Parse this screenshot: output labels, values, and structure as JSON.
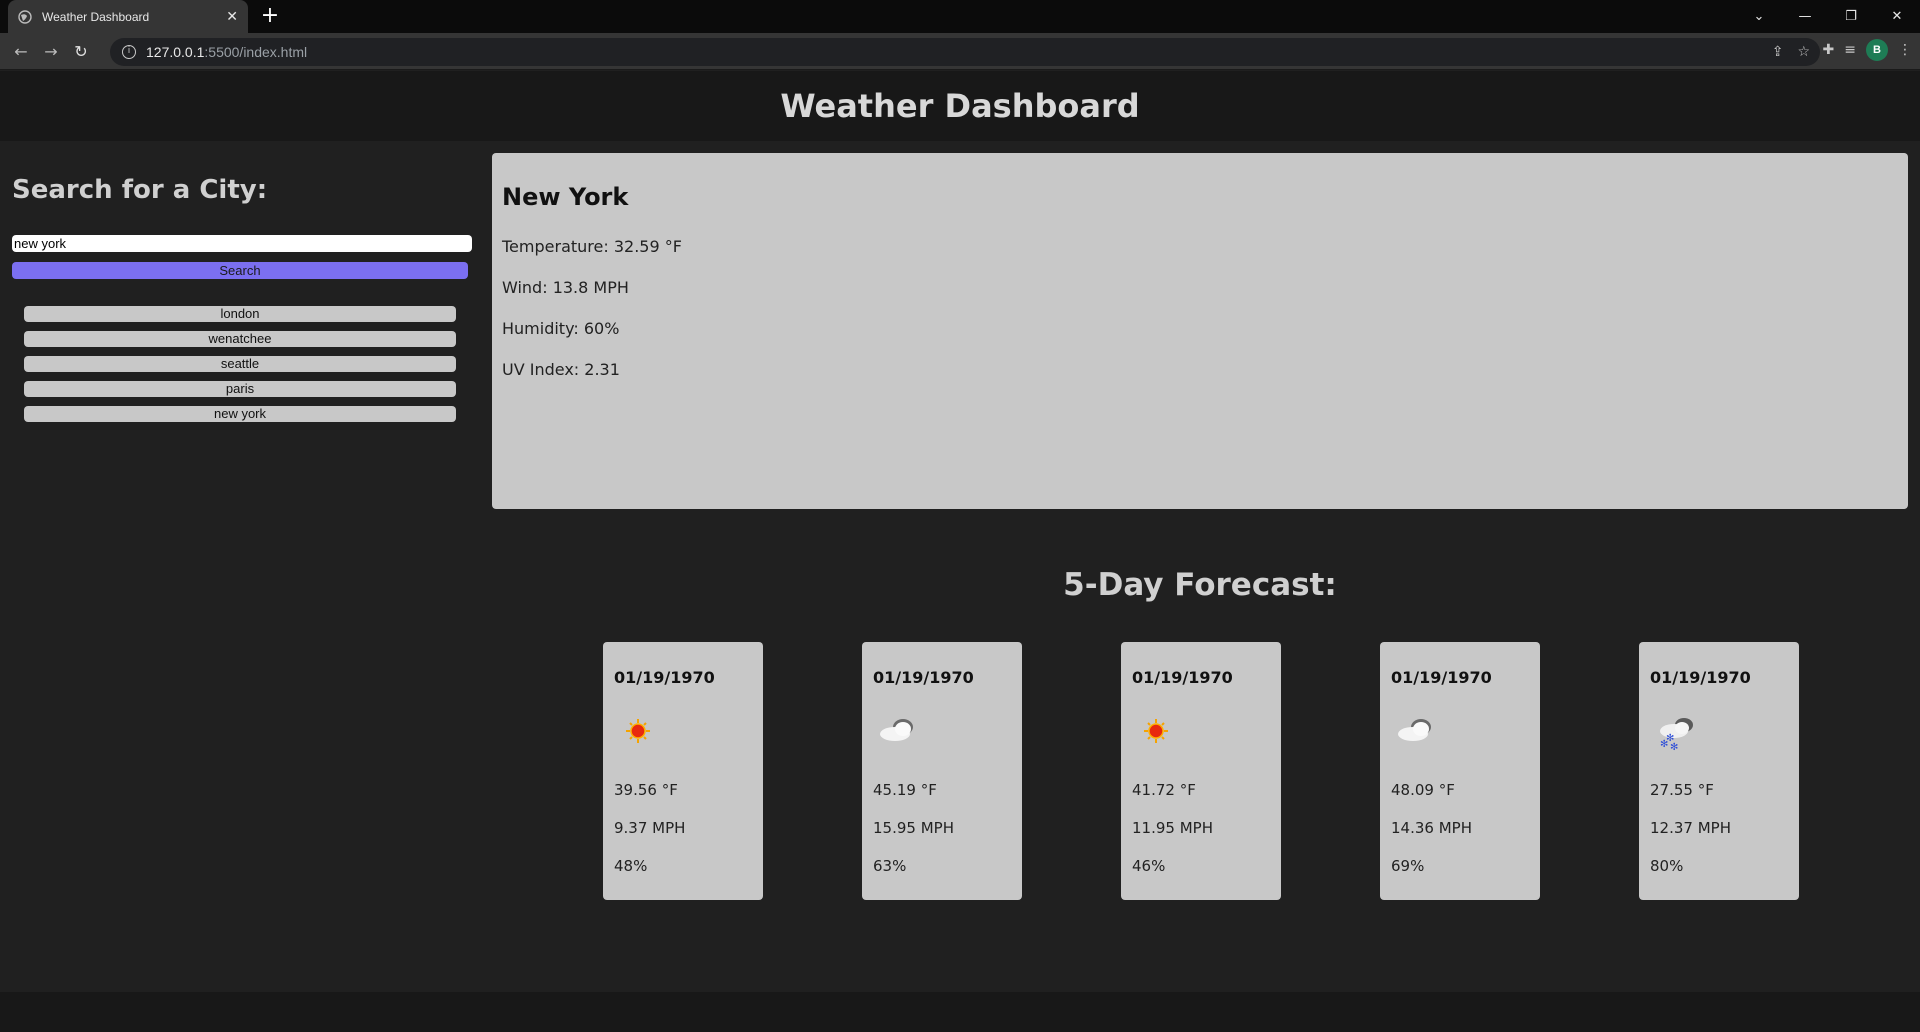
{
  "browser": {
    "tab_title": "Weather Dashboard",
    "url_host": "127.0.0.1",
    "url_path": ":5500/index.html",
    "profile_initial": "B"
  },
  "header": {
    "title": "Weather Dashboard"
  },
  "sidebar": {
    "heading": "Search for a City:",
    "search_value": "new york",
    "search_button": "Search",
    "history": [
      "london",
      "wenatchee",
      "seattle",
      "paris",
      "new york"
    ]
  },
  "current": {
    "city": "New York",
    "temperature": "Temperature: 32.59 °F",
    "wind": "Wind: 13.8 MPH",
    "humidity": "Humidity: 60%",
    "uv": "UV Index: 2.31"
  },
  "forecast": {
    "title": "5-Day Forecast:",
    "days": [
      {
        "date": "01/19/1970",
        "icon": "sun-icon",
        "temp": "39.56 °F",
        "wind": "9.37 MPH",
        "humidity": "48%"
      },
      {
        "date": "01/19/1970",
        "icon": "cloud-icon",
        "temp": "45.19 °F",
        "wind": "15.95 MPH",
        "humidity": "63%"
      },
      {
        "date": "01/19/1970",
        "icon": "sun-icon",
        "temp": "41.72 °F",
        "wind": "11.95 MPH",
        "humidity": "46%"
      },
      {
        "date": "01/19/1970",
        "icon": "cloud-icon",
        "temp": "48.09 °F",
        "wind": "14.36 MPH",
        "humidity": "69%"
      },
      {
        "date": "01/19/1970",
        "icon": "snow-cloud-icon",
        "temp": "27.55 °F",
        "wind": "12.37 MPH",
        "humidity": "80%"
      }
    ]
  },
  "colors": {
    "page_bg": "#202020",
    "header_bg": "#181818",
    "panel_bg": "#c8c8c8",
    "search_button": "#7b6ff0"
  }
}
